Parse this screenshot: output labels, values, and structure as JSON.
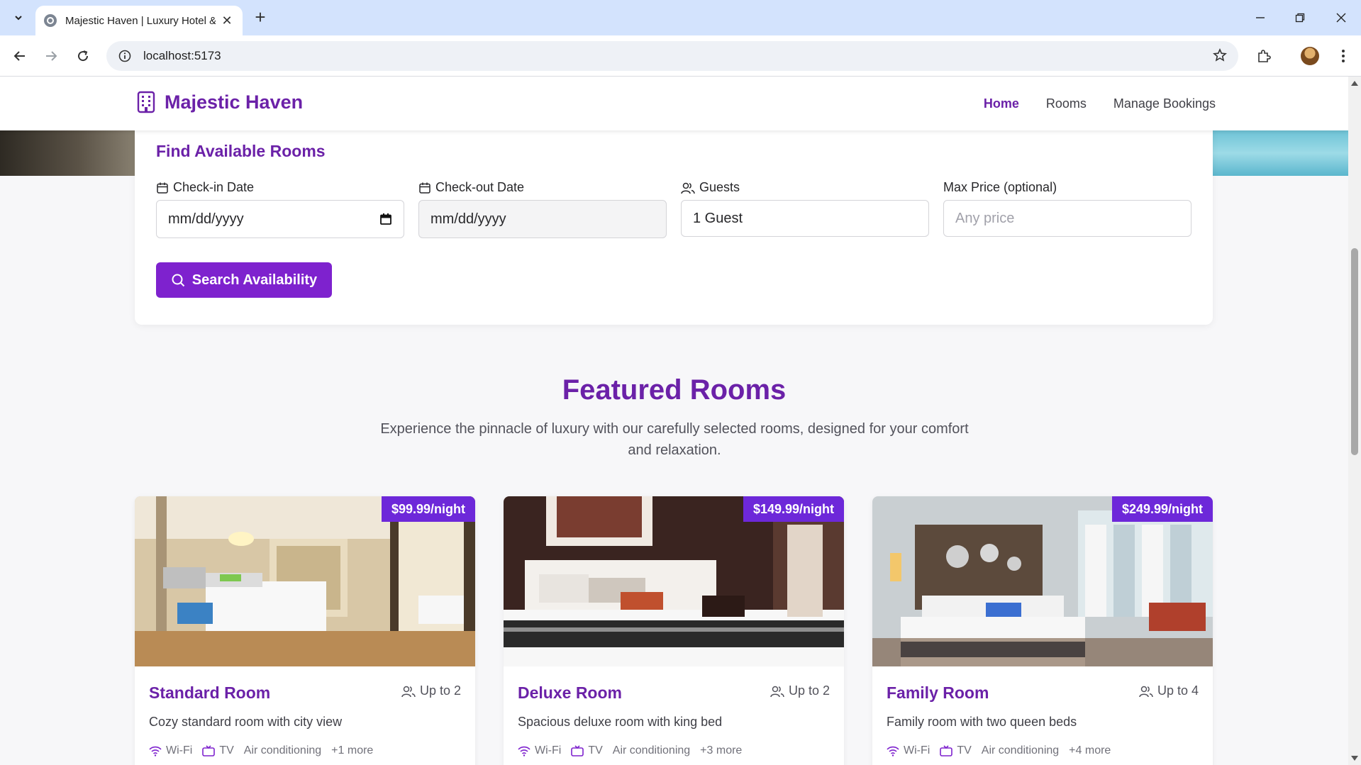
{
  "browser": {
    "tab_title": "Majestic Haven | Luxury Hotel &",
    "url": "localhost:5173"
  },
  "site": {
    "brand": "Majestic Haven",
    "nav": [
      "Home",
      "Rooms",
      "Manage Bookings"
    ],
    "accent": "#6b21a8"
  },
  "search": {
    "title": "Find Available Rooms",
    "checkin_label": "Check-in Date",
    "checkin_value": "mm/dd/yyyy",
    "checkout_label": "Check-out Date",
    "checkout_value": "mm/dd/yyyy",
    "guests_label": "Guests",
    "guests_value": "1 Guest",
    "price_label": "Max Price (optional)",
    "price_placeholder": "Any price",
    "button": "Search Availability"
  },
  "featured": {
    "title": "Featured Rooms",
    "subtitle": "Experience the pinnacle of luxury with our carefully selected rooms, designed for your comfort and relaxation."
  },
  "rooms": [
    {
      "price": "$99.99/night",
      "name": "Standard Room",
      "capacity": "Up to 2",
      "desc": "Cozy standard room with city view",
      "wifi": "Wi-Fi",
      "tv": "TV",
      "ac": "Air conditioning",
      "more": "+1 more"
    },
    {
      "price": "$149.99/night",
      "name": "Deluxe Room",
      "capacity": "Up to 2",
      "desc": "Spacious deluxe room with king bed",
      "wifi": "Wi-Fi",
      "tv": "TV",
      "ac": "Air conditioning",
      "more": "+3 more"
    },
    {
      "price": "$249.99/night",
      "name": "Family Room",
      "capacity": "Up to 4",
      "desc": "Family room with two queen beds",
      "wifi": "Wi-Fi",
      "tv": "TV",
      "ac": "Air conditioning",
      "more": "+4 more"
    }
  ]
}
